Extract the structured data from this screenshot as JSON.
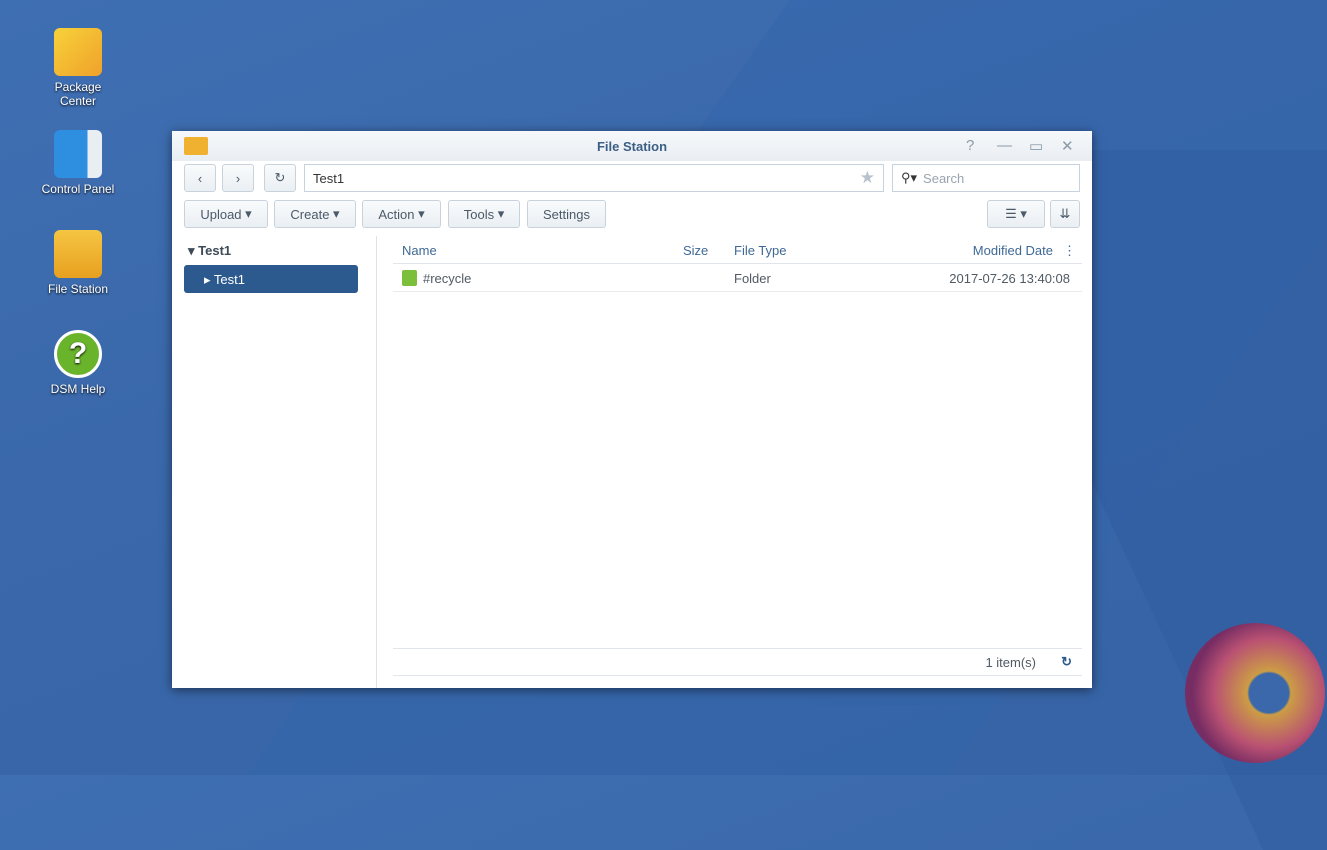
{
  "desktop": [
    {
      "label": "Package Center"
    },
    {
      "label": "Control Panel"
    },
    {
      "label": "File Station"
    },
    {
      "label": "DSM Help"
    }
  ],
  "window": {
    "title": "File Station",
    "path": "Test1",
    "search_placeholder": "Search",
    "toolbar": {
      "upload": "Upload",
      "create": "Create",
      "action": "Action",
      "tools": "Tools",
      "settings": "Settings"
    },
    "tree": {
      "root": "Test1",
      "child": "Test1"
    },
    "columns": {
      "name": "Name",
      "size": "Size",
      "type": "File Type",
      "modified": "Modified Date"
    },
    "rows": [
      {
        "name": "#recycle",
        "size": "",
        "type": "Folder",
        "modified": "2017-07-26 13:40:08"
      }
    ],
    "status": "1 item(s)"
  }
}
